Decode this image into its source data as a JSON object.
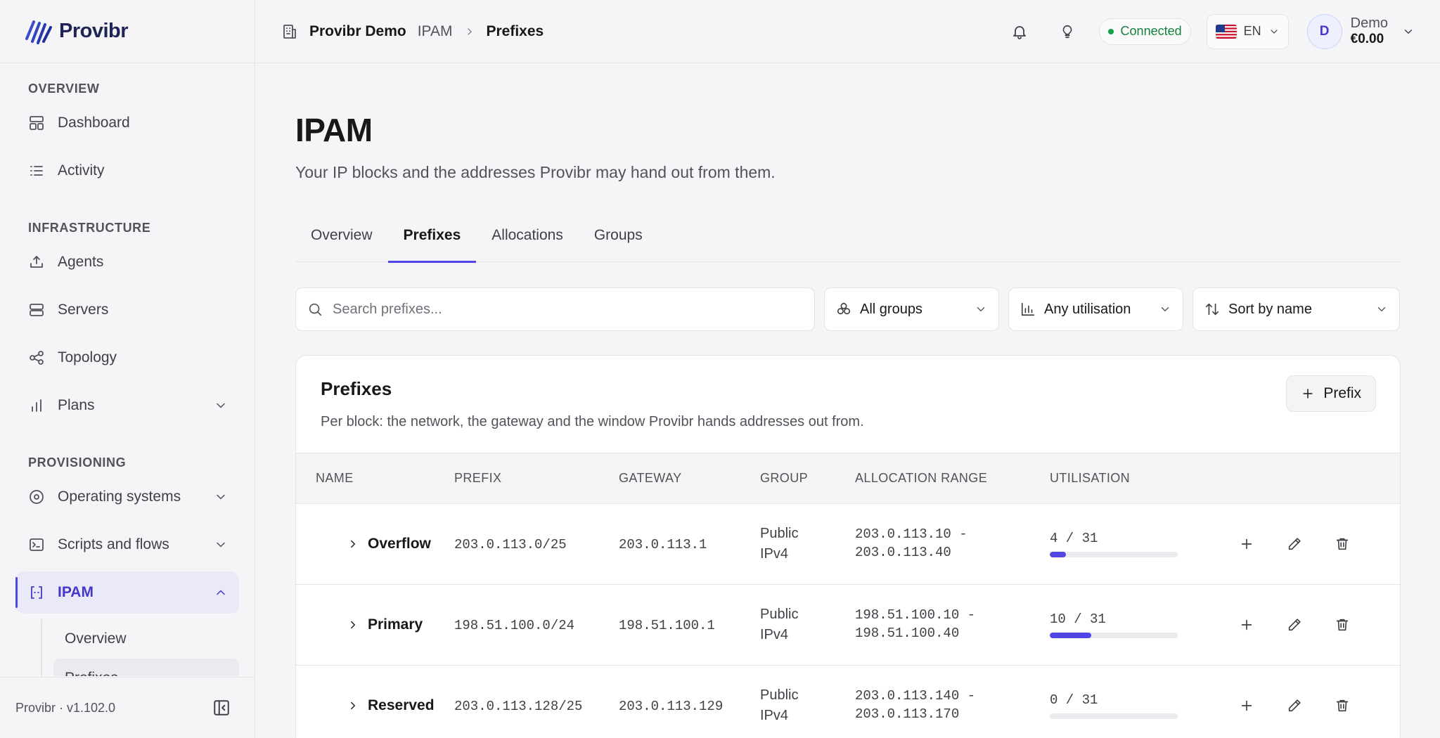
{
  "brand": {
    "name": "Provibr",
    "accent": "#4f46e5"
  },
  "sidebar": {
    "sections": [
      {
        "label": "OVERVIEW",
        "items": [
          {
            "label": "Dashboard",
            "icon": "dashboard-icon"
          },
          {
            "label": "Activity",
            "icon": "list-icon"
          }
        ]
      },
      {
        "label": "INFRASTRUCTURE",
        "items": [
          {
            "label": "Agents",
            "icon": "upload-tray-icon"
          },
          {
            "label": "Servers",
            "icon": "server-icon"
          },
          {
            "label": "Topology",
            "icon": "share-nodes-icon"
          },
          {
            "label": "Plans",
            "icon": "bar-chart-icon",
            "expandable": true
          }
        ]
      },
      {
        "label": "PROVISIONING",
        "items": [
          {
            "label": "Operating systems",
            "icon": "disc-icon",
            "expandable": true
          },
          {
            "label": "Scripts and flows",
            "icon": "terminal-icon",
            "expandable": true
          },
          {
            "label": "IPAM",
            "icon": "brackets-icon",
            "expandable": true,
            "active": true
          }
        ]
      }
    ],
    "ipam_sub": [
      {
        "label": "Overview"
      },
      {
        "label": "Prefixes",
        "selected": true
      }
    ],
    "footer": {
      "version": "Provibr · v1.102.0"
    }
  },
  "header": {
    "org": "Provibr Demo",
    "crumb": "IPAM",
    "current": "Prefixes",
    "status": "Connected",
    "lang": "EN",
    "account": {
      "initial": "D",
      "name": "Demo",
      "balance": "€0.00"
    }
  },
  "page": {
    "title": "IPAM",
    "subtitle": "Your IP blocks and the addresses Provibr may hand out from them.",
    "tabs": [
      "Overview",
      "Prefixes",
      "Allocations",
      "Groups"
    ],
    "active_tab": 1,
    "search_placeholder": "Search prefixes...",
    "filters": {
      "group": "All groups",
      "utilisation": "Any utilisation",
      "sort": "Sort by name"
    }
  },
  "card": {
    "title": "Prefixes",
    "description": "Per block: the network, the gateway and the window Provibr hands addresses out from.",
    "add_label": "Prefix",
    "columns": [
      "NAME",
      "PREFIX",
      "GATEWAY",
      "GROUP",
      "ALLOCATION RANGE",
      "UTILISATION"
    ],
    "rows": [
      {
        "name": "Overflow",
        "prefix": "203.0.113.0/25",
        "gateway": "203.0.113.1",
        "group_line1": "Public",
        "group_line2": "IPv4",
        "range_start": "203.0.113.10 -",
        "range_end": "203.0.113.40",
        "used": 4,
        "total": 31,
        "util_text": "4 / 31"
      },
      {
        "name": "Primary",
        "prefix": "198.51.100.0/24",
        "gateway": "198.51.100.1",
        "group_line1": "Public",
        "group_line2": "IPv4",
        "range_start": "198.51.100.10 -",
        "range_end": "198.51.100.40",
        "used": 10,
        "total": 31,
        "util_text": "10 / 31"
      },
      {
        "name": "Reserved",
        "prefix": "203.0.113.128/25",
        "gateway": "203.0.113.129",
        "group_line1": "Public",
        "group_line2": "IPv4",
        "range_start": "203.0.113.140 -",
        "range_end": "203.0.113.170",
        "used": 0,
        "total": 31,
        "util_text": "0 / 31"
      }
    ]
  }
}
